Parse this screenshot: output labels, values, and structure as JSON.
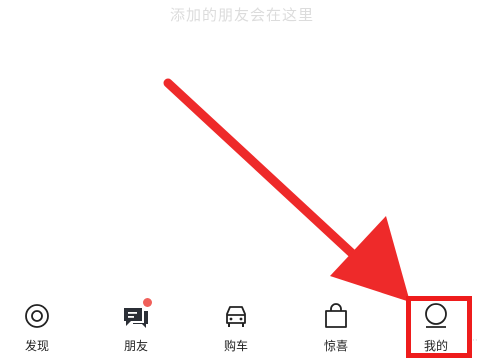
{
  "hint": "添加的朋友会在这里",
  "tabs": [
    {
      "label": "发现",
      "icon": "target-icon"
    },
    {
      "label": "朋友",
      "icon": "chat-icon"
    },
    {
      "label": "购车",
      "icon": "car-icon"
    },
    {
      "label": "惊喜",
      "icon": "bag-icon"
    },
    {
      "label": "我的",
      "icon": "profile-icon"
    }
  ],
  "annotation_color": "#ee1c1c",
  "badge_color": "#f0605a"
}
